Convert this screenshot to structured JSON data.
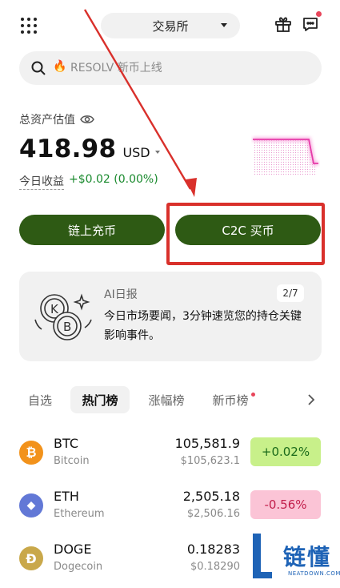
{
  "header": {
    "exchange_label": "交易所",
    "icons": [
      "grid-menu-icon",
      "gift-icon",
      "message-icon"
    ]
  },
  "search": {
    "placeholder": "RESOLV 新币上线",
    "hot_icon": "fire-icon"
  },
  "assets": {
    "label": "总资产估值",
    "amount": "418.98",
    "currency": "USD",
    "pnl_label": "今日收益",
    "pnl_value": "+$0.02 (0.00%)"
  },
  "actions": {
    "deposit_label": "链上充币",
    "c2c_label": "C2C 买币"
  },
  "ai_report": {
    "title": "AI日报",
    "pager": "2/7",
    "text": "今日市场要闻，3分钟速览您的持仓关键影响事件。"
  },
  "tabs": [
    {
      "label": "自选",
      "active": false
    },
    {
      "label": "热门榜",
      "active": true
    },
    {
      "label": "涨幅榜",
      "active": false
    },
    {
      "label": "新币榜",
      "active": false,
      "dot": true
    }
  ],
  "coins": [
    {
      "symbol": "BTC",
      "name": "Bitcoin",
      "price": "105,581.9",
      "fiat": "$105,623.1",
      "change": "+0.02%",
      "direction": "up",
      "logo_color": "#f2921b",
      "logo_glyph": "₿"
    },
    {
      "symbol": "ETH",
      "name": "Ethereum",
      "price": "2,505.18",
      "fiat": "$2,506.16",
      "change": "-0.56%",
      "direction": "down",
      "logo_color": "#6278d6",
      "logo_glyph": "◆"
    },
    {
      "symbol": "DOGE",
      "name": "Dogecoin",
      "price": "0.18283",
      "fiat": "$0.18290",
      "change": "",
      "direction": "none",
      "logo_color": "#c9a84a",
      "logo_glyph": "Ð"
    }
  ],
  "watermark": {
    "cn": "链懂",
    "en": "NEATDOWN.COM"
  },
  "colors": {
    "primary_button": "#2e5a14",
    "up_bg": "#c8f08a",
    "up_text": "#1a6a1a",
    "down_bg": "#fbc4d6",
    "down_text": "#c21d4a",
    "annotation_red": "#d9302b",
    "sparkline": "#e53aa8"
  }
}
